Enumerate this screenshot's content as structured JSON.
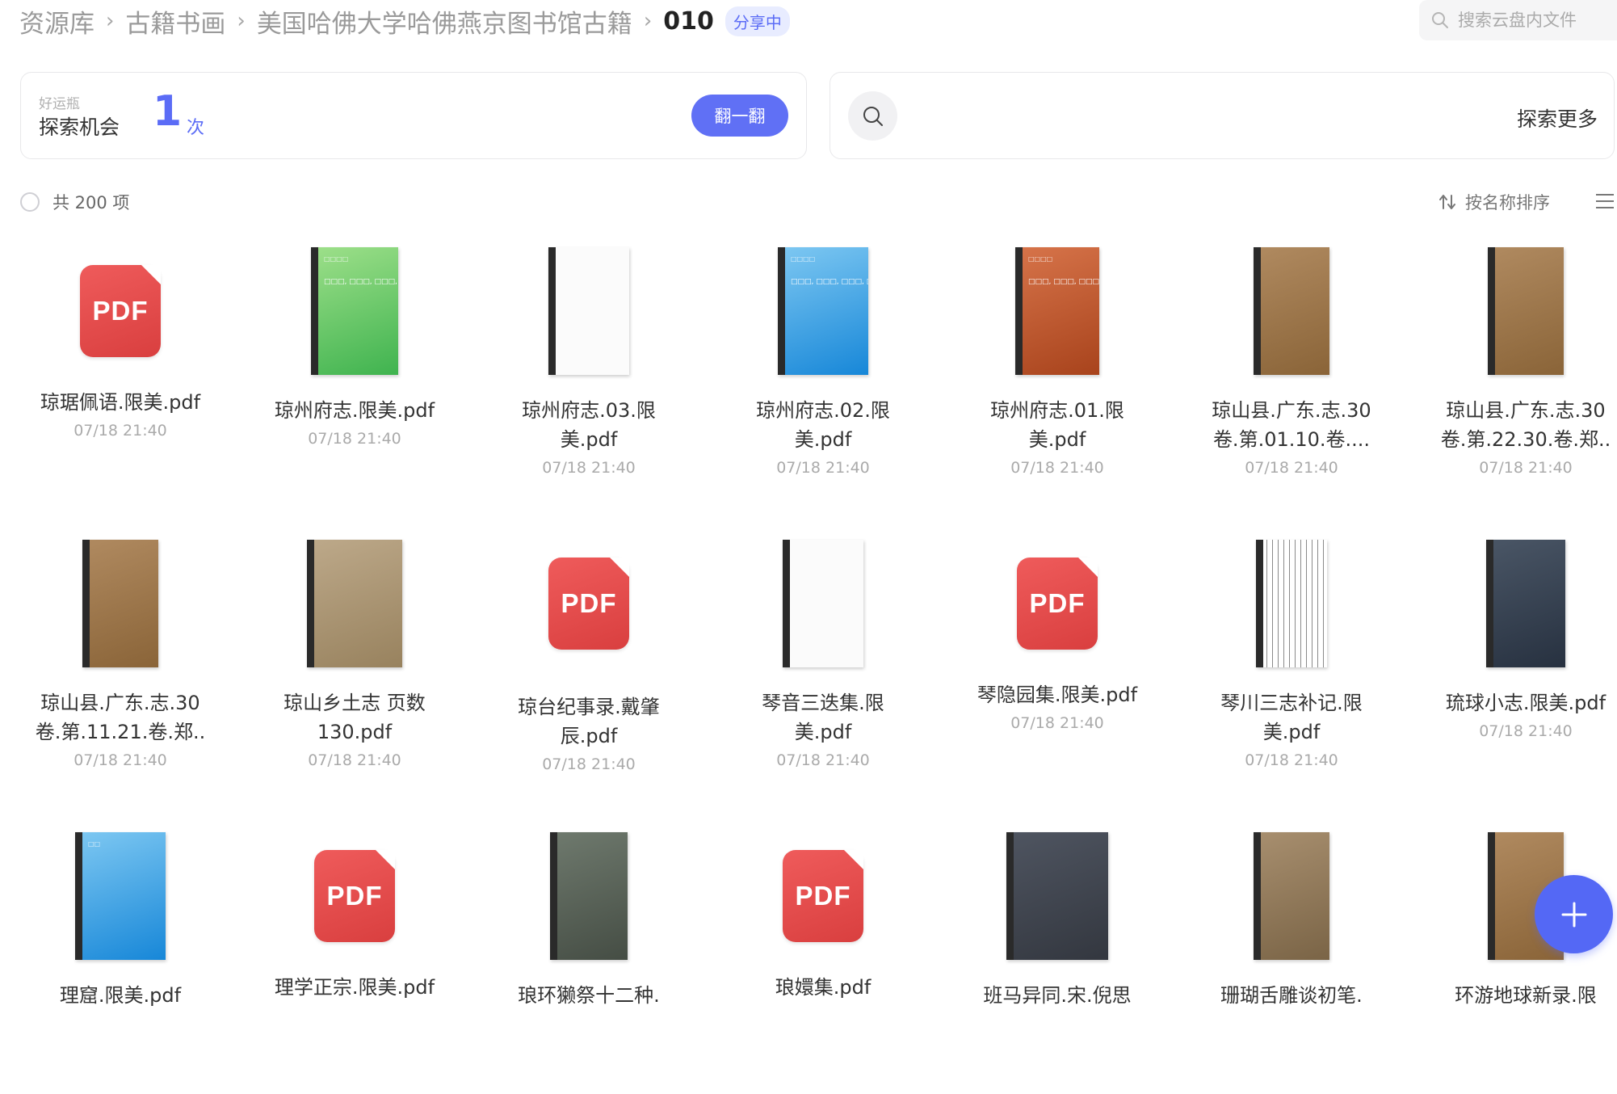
{
  "breadcrumb": {
    "items": [
      "资源库",
      "古籍书画",
      "美国哈佛大学哈佛燕京图书馆古籍"
    ],
    "current": "010",
    "badge": "分享中"
  },
  "search": {
    "placeholder": "搜索云盘内文件"
  },
  "lucky_card": {
    "small_label": "好运瓶",
    "title": "探索机会",
    "count": "1",
    "unit": "次",
    "button": "翻一翻"
  },
  "explore_card": {
    "label": "探索更多",
    "icon": "search-icon"
  },
  "toolbar": {
    "total": "共 200 项",
    "sort_label": "按名称排序"
  },
  "files": [
    {
      "name": "琼琚佩语.限美.pdf",
      "date": "07/18 21:40",
      "thumb": "pdf"
    },
    {
      "name": "琼州府志.限美.pdf",
      "date": "07/18 21:40",
      "thumb": "book-green",
      "cover_text": "□□□, □□□, □□□, □□□",
      "cover_small": "□□□□"
    },
    {
      "name": "琼州府志.03.限\n美.pdf",
      "date": "07/18 21:40",
      "thumb": "book-white"
    },
    {
      "name": "琼州府志.02.限\n美.pdf",
      "date": "07/18 21:40",
      "thumb": "book-blue",
      "cover_text": "□□□, □□□, □□□, □□□",
      "cover_small": "□□□□"
    },
    {
      "name": "琼州府志.01.限\n美.pdf",
      "date": "07/18 21:40",
      "thumb": "book-orange",
      "cover_text": "□□□, □□□, □□□, □□□",
      "cover_small": "□□□□"
    },
    {
      "name": "琼山县.广东.志.30\n卷.第.01.10.卷....",
      "date": "07/18 21:40",
      "thumb": "book-brown"
    },
    {
      "name": "琼山县.广东.志.30\n卷.第.22.30.卷.郑..",
      "date": "07/18 21:40",
      "thumb": "book-brown"
    },
    {
      "name": "琼山县.广东.志.30\n卷.第.11.21.卷.郑..",
      "date": "07/18 21:40",
      "thumb": "book-brown"
    },
    {
      "name": "琼山乡土志 页数\n130.pdf",
      "date": "07/18 21:40",
      "thumb": "book-tan"
    },
    {
      "name": "琼台纪事录.戴肇\n辰.pdf",
      "date": "07/18 21:40",
      "thumb": "pdf"
    },
    {
      "name": "琴音三迭集.限\n美.pdf",
      "date": "07/18 21:40",
      "thumb": "book-white"
    },
    {
      "name": "琴隐园集.限美.pdf",
      "date": "07/18 21:40",
      "thumb": "pdf"
    },
    {
      "name": "琴川三志补记.限\n美.pdf",
      "date": "07/18 21:40",
      "thumb": "book-text"
    },
    {
      "name": "琉球小志.限美.pdf",
      "date": "07/18 21:40",
      "thumb": "book-navy"
    },
    {
      "name": "理窟.限美.pdf",
      "date": "",
      "thumb": "book-blue",
      "cover_small": "□□"
    },
    {
      "name": "理学正宗.限美.pdf",
      "date": "",
      "thumb": "pdf"
    },
    {
      "name": "琅环獭祭十二种.",
      "date": "",
      "thumb": "book-gray"
    },
    {
      "name": "琅嬛集.pdf",
      "date": "",
      "thumb": "pdf"
    },
    {
      "name": "班马异同.宋.倪思",
      "date": "",
      "thumb": "book-dark"
    },
    {
      "name": "珊瑚舌雕谈初笔.",
      "date": "",
      "thumb": "book-calli"
    },
    {
      "name": "环游地球新录.限",
      "date": "",
      "thumb": "book-brown"
    }
  ],
  "fab": {
    "icon": "plus-icon"
  },
  "colors": {
    "accent": "#5b6cf6",
    "pdf_red": "#e04848",
    "text_muted": "#aaaaaa"
  }
}
